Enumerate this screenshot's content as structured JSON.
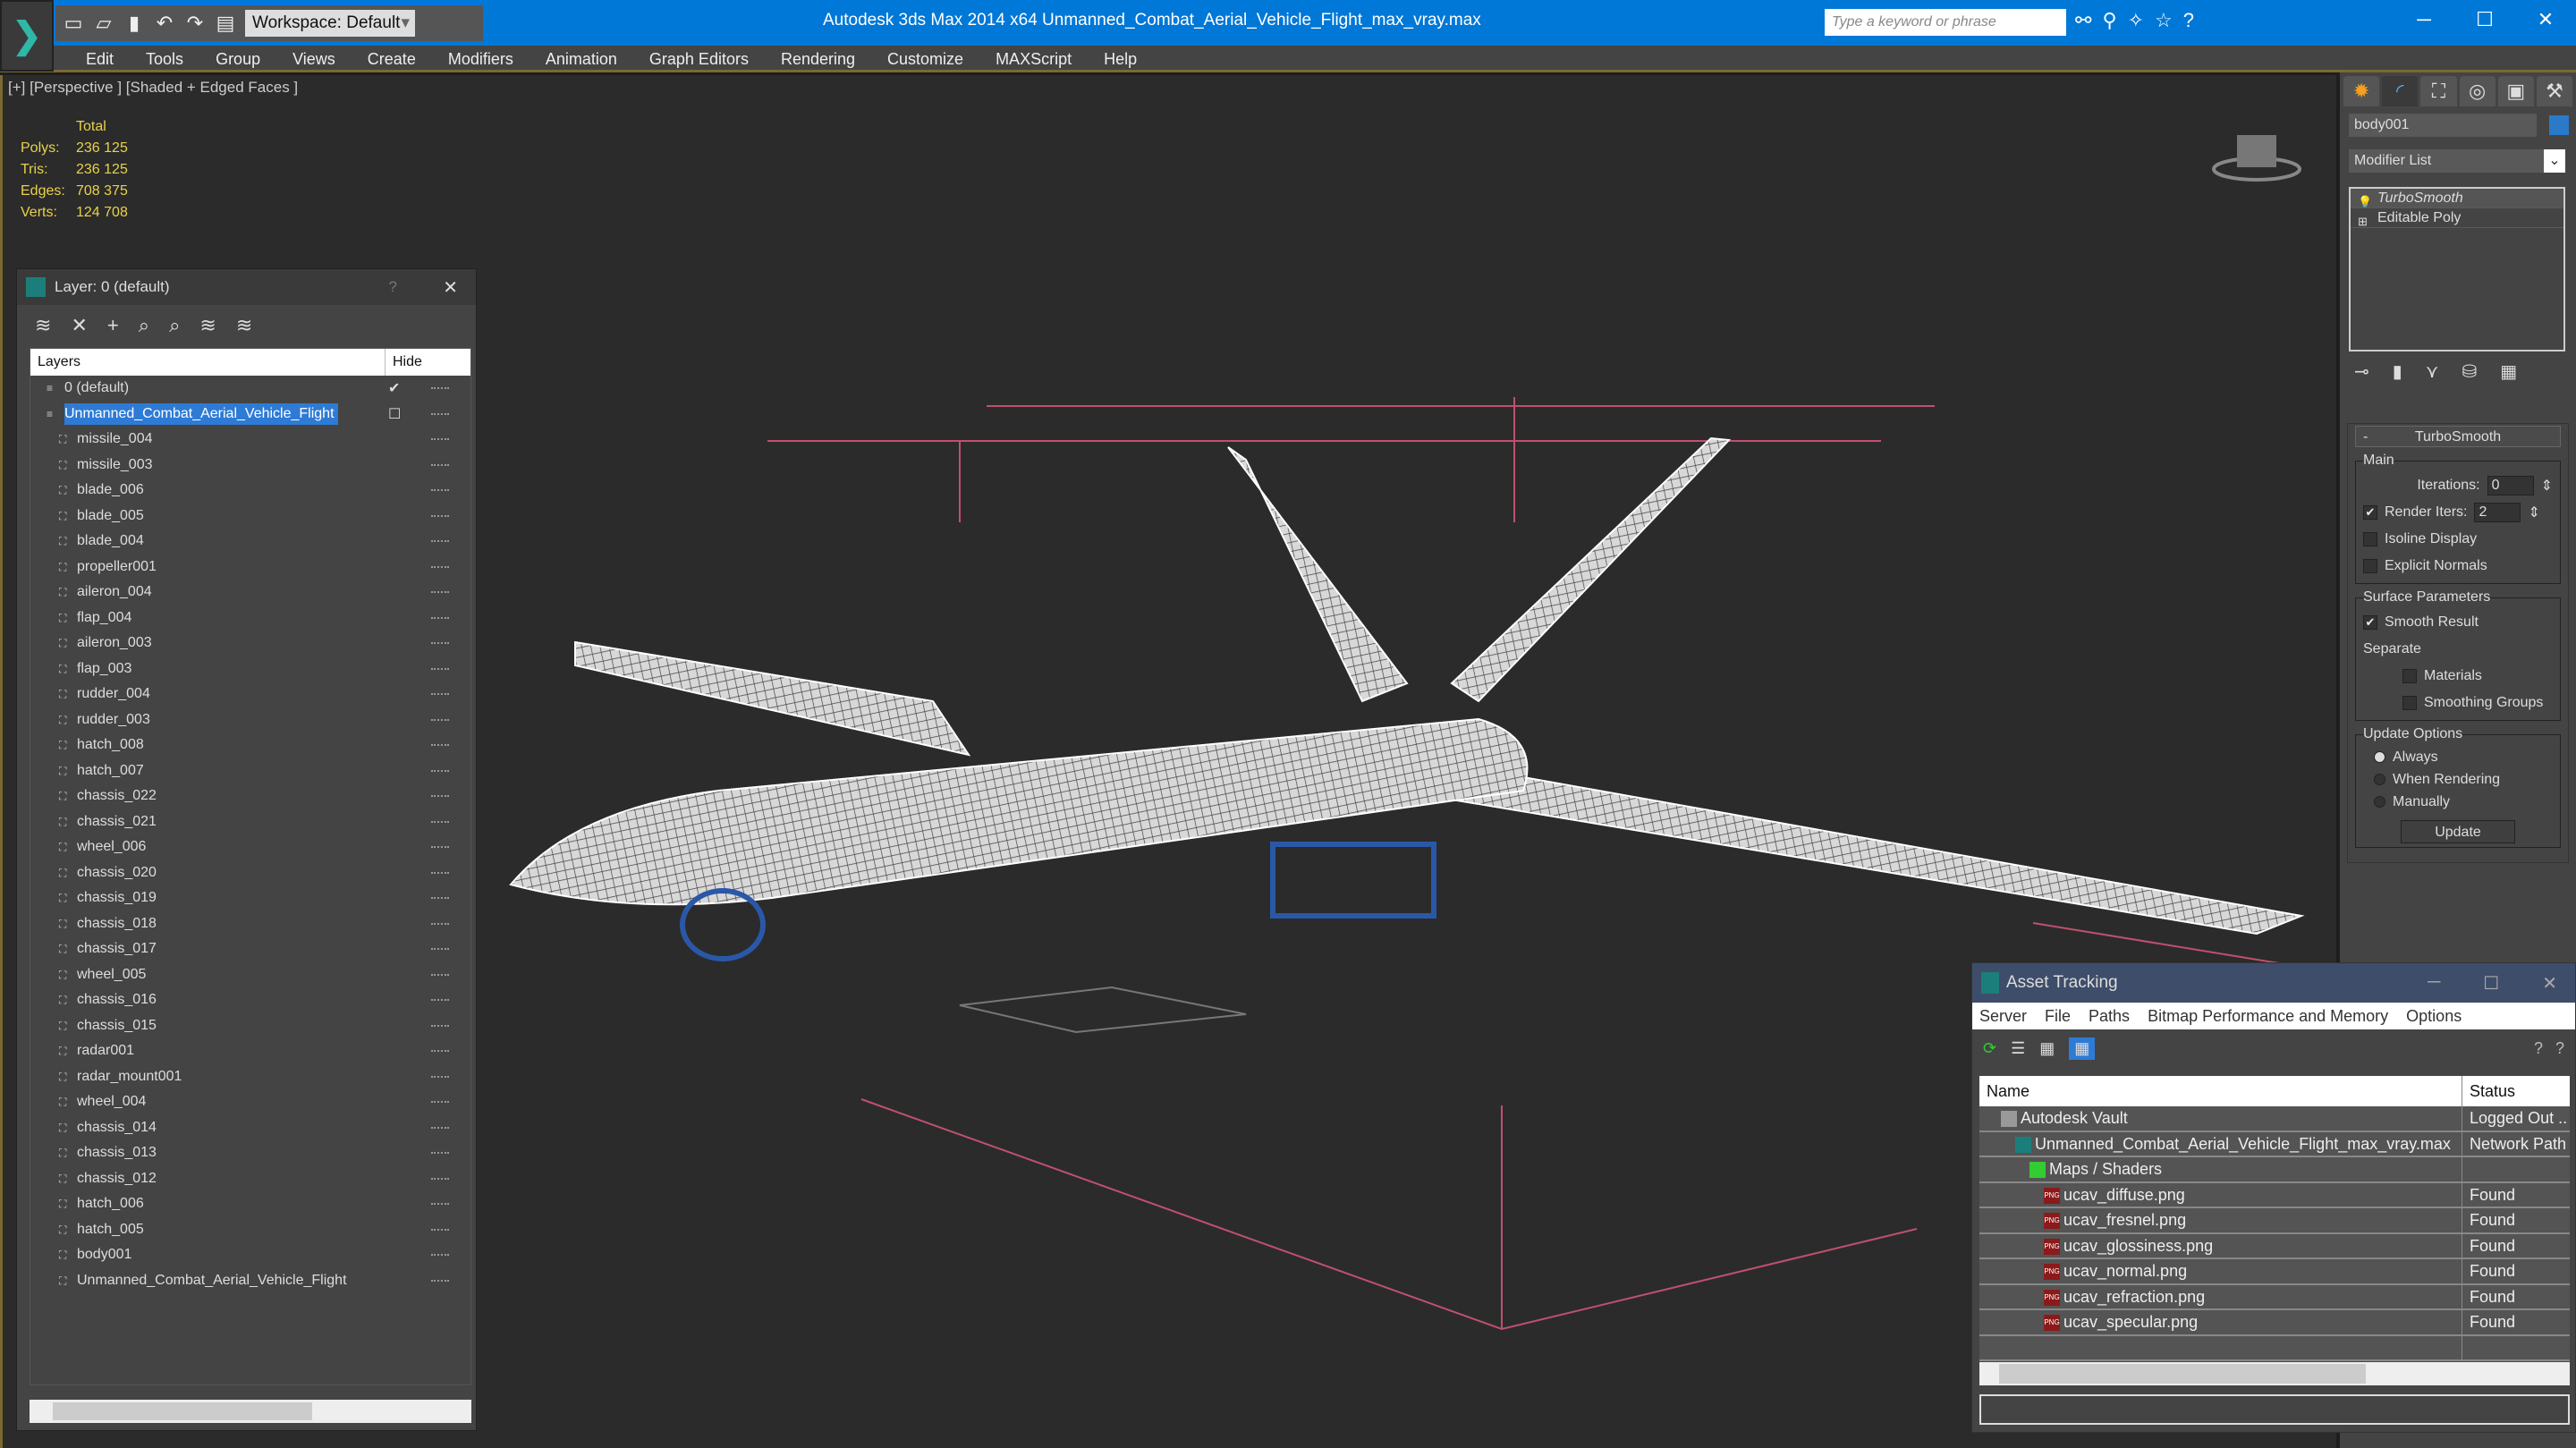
{
  "titlebar": {
    "app_title": "Autodesk 3ds Max  2014 x64     Unmanned_Combat_Aerial_Vehicle_Flight_max_vray.max",
    "workspace": "Workspace: Default",
    "search_placeholder": "Type a keyword or phrase"
  },
  "menu": [
    "Edit",
    "Tools",
    "Group",
    "Views",
    "Create",
    "Modifiers",
    "Animation",
    "Graph Editors",
    "Rendering",
    "Customize",
    "MAXScript",
    "Help"
  ],
  "viewport": {
    "label": "[+] [Perspective ] [Shaded + Edged Faces ]",
    "stats": {
      "header": "Total",
      "rows": [
        {
          "k": "Polys:",
          "v": "236 125"
        },
        {
          "k": "Tris:",
          "v": "236 125"
        },
        {
          "k": "Edges:",
          "v": "708 375"
        },
        {
          "k": "Verts:",
          "v": "124 708"
        }
      ]
    }
  },
  "layer_panel": {
    "title": "Layer: 0 (default)",
    "help": "?",
    "col_layers": "Layers",
    "col_hide": "Hide",
    "items": [
      {
        "name": "0 (default)",
        "level": 1,
        "checked": true
      },
      {
        "name": "Unmanned_Combat_Aerial_Vehicle_Flight",
        "level": 1,
        "selected": true
      },
      {
        "name": "missile_004",
        "level": 2
      },
      {
        "name": "missile_003",
        "level": 2
      },
      {
        "name": "blade_006",
        "level": 2
      },
      {
        "name": "blade_005",
        "level": 2
      },
      {
        "name": "blade_004",
        "level": 2
      },
      {
        "name": "propeller001",
        "level": 2
      },
      {
        "name": "aileron_004",
        "level": 2
      },
      {
        "name": "flap_004",
        "level": 2
      },
      {
        "name": "aileron_003",
        "level": 2
      },
      {
        "name": "flap_003",
        "level": 2
      },
      {
        "name": "rudder_004",
        "level": 2
      },
      {
        "name": "rudder_003",
        "level": 2
      },
      {
        "name": "hatch_008",
        "level": 2
      },
      {
        "name": "hatch_007",
        "level": 2
      },
      {
        "name": "chassis_022",
        "level": 2
      },
      {
        "name": "chassis_021",
        "level": 2
      },
      {
        "name": "wheel_006",
        "level": 2
      },
      {
        "name": "chassis_020",
        "level": 2
      },
      {
        "name": "chassis_019",
        "level": 2
      },
      {
        "name": "chassis_018",
        "level": 2
      },
      {
        "name": "chassis_017",
        "level": 2
      },
      {
        "name": "wheel_005",
        "level": 2
      },
      {
        "name": "chassis_016",
        "level": 2
      },
      {
        "name": "chassis_015",
        "level": 2
      },
      {
        "name": "radar001",
        "level": 2
      },
      {
        "name": "radar_mount001",
        "level": 2
      },
      {
        "name": "wheel_004",
        "level": 2
      },
      {
        "name": "chassis_014",
        "level": 2
      },
      {
        "name": "chassis_013",
        "level": 2
      },
      {
        "name": "chassis_012",
        "level": 2
      },
      {
        "name": "hatch_006",
        "level": 2
      },
      {
        "name": "hatch_005",
        "level": 2
      },
      {
        "name": "body001",
        "level": 2
      },
      {
        "name": "Unmanned_Combat_Aerial_Vehicle_Flight",
        "level": 2
      }
    ]
  },
  "command_panel": {
    "object_name": "body001",
    "object_color": "#2a7ac8",
    "modifier_list": "Modifier List",
    "stack": [
      "TurboSmooth",
      "Editable Poly"
    ],
    "rollout": "TurboSmooth",
    "main": "Main",
    "iterations_label": "Iterations:",
    "iterations": "0",
    "render_iters_label": "Render Iters:",
    "render_iters": "2",
    "render_iters_checked": true,
    "isoline": "Isoline Display",
    "explicit_normals": "Explicit Normals",
    "surface_params": "Surface Parameters",
    "smooth_result": "Smooth Result",
    "separate": "Separate",
    "materials": "Materials",
    "smoothing_groups": "Smoothing Groups",
    "update_options": "Update Options",
    "opt_always": "Always",
    "opt_when_rendering": "When Rendering",
    "opt_manually": "Manually",
    "selected_option": "Always",
    "update": "Update"
  },
  "asset_tracking": {
    "title": "Asset Tracking",
    "menu": [
      "Server",
      "File",
      "Paths",
      "Bitmap Performance and Memory",
      "Options"
    ],
    "col_name": "Name",
    "col_status": "Status",
    "rows": [
      {
        "name": "Autodesk Vault",
        "status": "Logged Out ..",
        "indent": 1,
        "icon": "vault"
      },
      {
        "name": "Unmanned_Combat_Aerial_Vehicle_Flight_max_vray.max",
        "status": "Network Path",
        "indent": 2,
        "icon": "max"
      },
      {
        "name": "Maps / Shaders",
        "status": "",
        "indent": 3,
        "icon": "maps"
      },
      {
        "name": "ucav_diffuse.png",
        "status": "Found",
        "indent": 4,
        "icon": "png"
      },
      {
        "name": "ucav_fresnel.png",
        "status": "Found",
        "indent": 4,
        "icon": "png"
      },
      {
        "name": "ucav_glossiness.png",
        "status": "Found",
        "indent": 4,
        "icon": "png"
      },
      {
        "name": "ucav_normal.png",
        "status": "Found",
        "indent": 4,
        "icon": "png"
      },
      {
        "name": "ucav_refraction.png",
        "status": "Found",
        "indent": 4,
        "icon": "png"
      },
      {
        "name": "ucav_specular.png",
        "status": "Found",
        "indent": 4,
        "icon": "png"
      }
    ]
  }
}
